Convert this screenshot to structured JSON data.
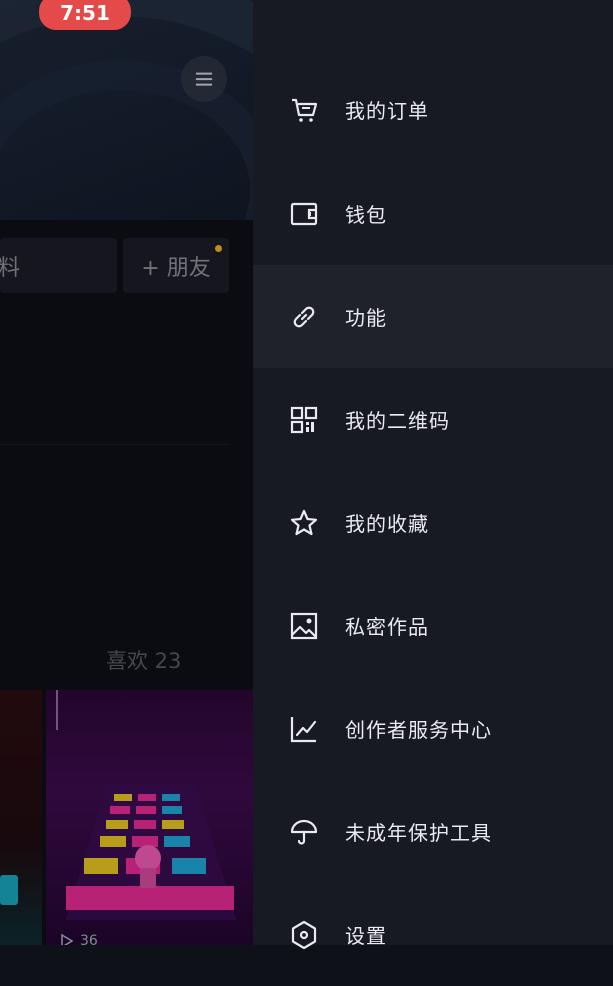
{
  "status_bar": {
    "time": "7:51"
  },
  "profile": {
    "edit_fragment": "料",
    "add_friend_label": "+ 朋友",
    "likes_tab": "喜欢 23",
    "view_count": "36"
  },
  "drawer": {
    "items": [
      {
        "label": "我的订单",
        "icon": "cart-icon"
      },
      {
        "label": "钱包",
        "icon": "wallet-icon"
      },
      {
        "label": "功能",
        "icon": "link-icon"
      },
      {
        "label": "我的二维码",
        "icon": "qr-code-icon"
      },
      {
        "label": "我的收藏",
        "icon": "star-icon"
      },
      {
        "label": "私密作品",
        "icon": "private-image-icon"
      },
      {
        "label": "创作者服务中心",
        "icon": "chart-icon"
      },
      {
        "label": "未成年保护工具",
        "icon": "umbrella-icon"
      },
      {
        "label": "设置",
        "icon": "settings-hexagon-icon"
      }
    ],
    "active_index": 2
  },
  "colors": {
    "drawer_bg": "#171a23",
    "active_item_bg": "#1f222b",
    "time_pill": "#e54a4a",
    "notification_dot": "#e8b020"
  }
}
